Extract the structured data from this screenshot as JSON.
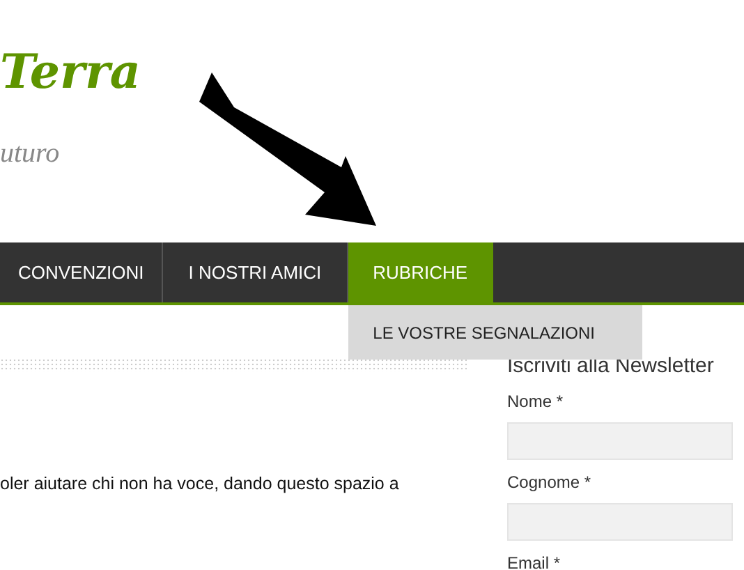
{
  "logo": {
    "title": "Terra",
    "tagline": "uturo"
  },
  "nav": {
    "items": [
      {
        "label": "CONVENZIONI",
        "selected": false
      },
      {
        "label": "I NOSTRI AMICI",
        "selected": false
      },
      {
        "label": "RUBRICHE",
        "selected": true,
        "submenu": [
          "LE VOSTRE SEGNALAZIONI"
        ]
      }
    ]
  },
  "content": {
    "text": "oler aiutare chi non ha voce, dando questo spazio a"
  },
  "newsletter": {
    "title": "Iscriviti alla Newsletter",
    "fields": [
      {
        "label": "Nome *"
      },
      {
        "label": "Cognome *"
      },
      {
        "label": "Email *"
      }
    ]
  }
}
